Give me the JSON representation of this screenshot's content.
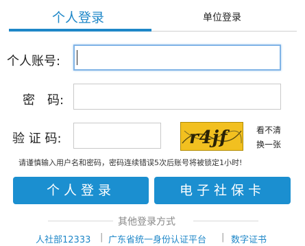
{
  "tabs": {
    "personal": "个人登录",
    "unit": "单位登录"
  },
  "form": {
    "account_label": "个人账号:",
    "password_label": "密　码:",
    "captcha_label": "验 证 码:",
    "account_value": "",
    "password_value": "",
    "captcha_value": "",
    "captcha_text": "r4jf",
    "refresh_line1": "看不清",
    "refresh_line2": "换一张"
  },
  "notice": "请谨慎输入用户名和密码，密码连续错误5次后账号将被锁定1小时!",
  "buttons": {
    "personal_login": "个人登录",
    "social_card": "电子社保卡"
  },
  "other_login": {
    "title": "其他登录方式",
    "links": [
      "人社部12333",
      "广东省统一身份认证平台",
      "数字证书"
    ],
    "separator": "|"
  },
  "colors": {
    "accent": "#1e87c8",
    "button": "#1b8fd0",
    "captcha_bg": "#f2c020"
  }
}
